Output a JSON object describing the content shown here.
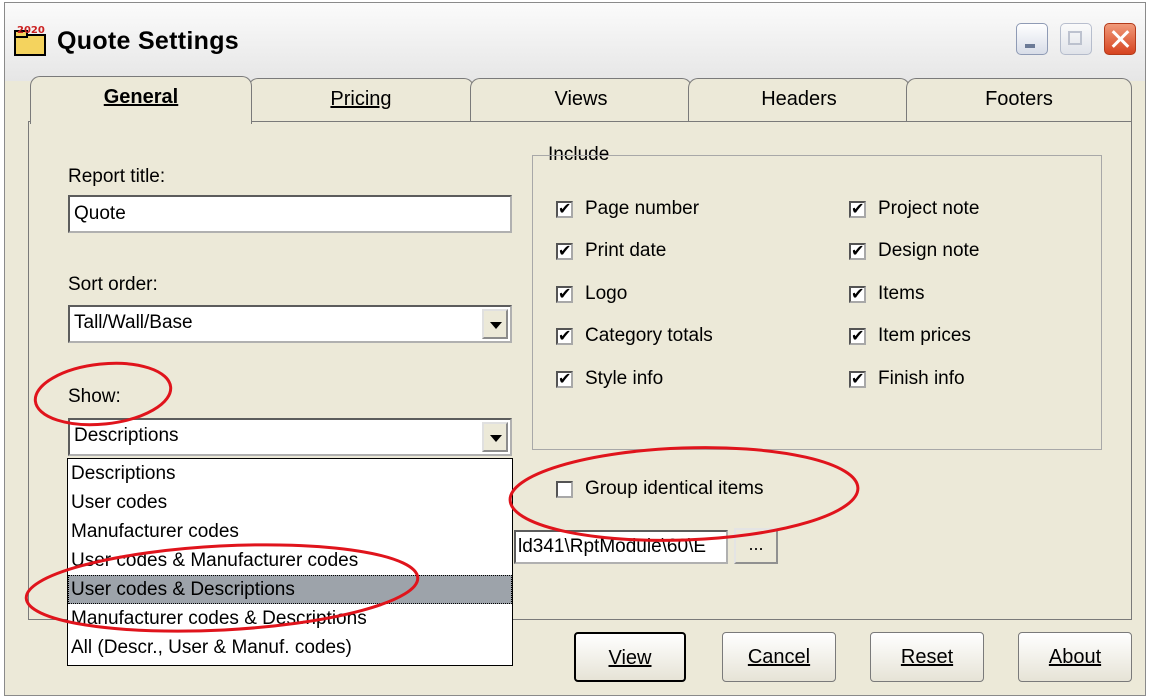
{
  "window": {
    "title": "Quote Settings",
    "app_icon_text": "2020"
  },
  "tabs": [
    {
      "label": "General",
      "active": true
    },
    {
      "label": "Pricing",
      "active": false
    },
    {
      "label": "Views",
      "active": false
    },
    {
      "label": "Headers",
      "active": false
    },
    {
      "label": "Footers",
      "active": false
    }
  ],
  "general": {
    "report_title_label": "Report title:",
    "report_title_value": "Quote",
    "sort_order_label": "Sort order:",
    "sort_order_value": "Tall/Wall/Base",
    "show_label": "Show:",
    "show_value": "Descriptions",
    "show_options": [
      "Descriptions",
      "User codes",
      "Manufacturer codes",
      "User codes & Manufacturer codes",
      "User codes & Descriptions",
      "Manufacturer codes & Descriptions",
      "All (Descr., User & Manuf. codes)"
    ],
    "show_highlighted": "User codes & Descriptions",
    "include_title": "Include",
    "include": [
      {
        "label": "Page number",
        "checked": true
      },
      {
        "label": "Print date",
        "checked": true
      },
      {
        "label": "Logo",
        "checked": true
      },
      {
        "label": "Category totals",
        "checked": true
      },
      {
        "label": "Style info",
        "checked": true
      },
      {
        "label": "Project note",
        "checked": true
      },
      {
        "label": "Design note",
        "checked": true
      },
      {
        "label": "Items",
        "checked": true
      },
      {
        "label": "Item prices",
        "checked": true
      },
      {
        "label": "Finish info",
        "checked": true
      }
    ],
    "group_identical_label": "Group identical items",
    "group_identical_checked": false,
    "template_path": "ld341\\RptModule\\60\\E",
    "browse_label": "..."
  },
  "buttons": {
    "view": "View",
    "cancel": "Cancel",
    "reset": "Reset",
    "about": "About"
  },
  "colors": {
    "dialog_bg": "#ece9d8",
    "annotation_red": "#e0141c",
    "selection_gray": "#9da3aa"
  }
}
